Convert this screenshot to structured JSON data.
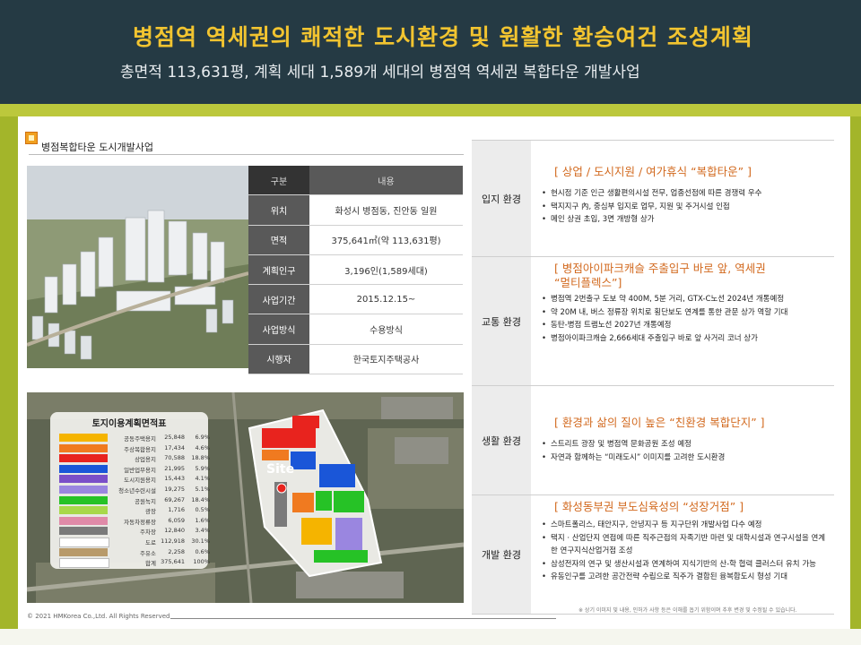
{
  "header": {
    "title": "병점역 역세권의 쾌적한 도시환경 및 원활한 환승여건 조성계획",
    "subtitle": "총면적 113,631평, 계획 세대 1,589개 세대의 병점역 역세권 복합타운 개발사업"
  },
  "section": {
    "title": "병점복합타운 도시개발사업"
  },
  "info": {
    "head": {
      "key": "구분",
      "value": "내용"
    },
    "rows": [
      {
        "key": "위치",
        "value": "화성시 병점동, 진안동 일원"
      },
      {
        "key": "면적",
        "value": "375,641㎡(약 113,631평)"
      },
      {
        "key": "계획인구",
        "value": "3,196인(1,589세대)"
      },
      {
        "key": "사업기간",
        "value": "2015.12.15~"
      },
      {
        "key": "사업방식",
        "value": "수용방식"
      },
      {
        "key": "시행자",
        "value": "한국토지주택공사"
      }
    ]
  },
  "legend": {
    "title": "토지이용계획면적표",
    "rows": [
      {
        "name": "공동주택용지",
        "area": "25,848",
        "pct": "6.9%",
        "color": "#f5b400"
      },
      {
        "name": "주상복합용지",
        "area": "17,434",
        "pct": "4.6%",
        "color": "#f07a20"
      },
      {
        "name": "상업용지",
        "area": "70,588",
        "pct": "18.8%",
        "color": "#e8231e"
      },
      {
        "name": "일반업무용지",
        "area": "21,995",
        "pct": "5.9%",
        "color": "#1a56d8"
      },
      {
        "name": "도시지원용지",
        "area": "15,443",
        "pct": "4.1%",
        "color": "#7a4fc8"
      },
      {
        "name": "청소년수련시설",
        "area": "19,275",
        "pct": "5.1%",
        "color": "#9a86e0"
      },
      {
        "name": "공원녹지",
        "area": "69,267",
        "pct": "18.4%",
        "color": "#26c226"
      },
      {
        "name": "광장",
        "area": "1,716",
        "pct": "0.5%",
        "color": "#a8d84a"
      },
      {
        "name": "자동차정류장",
        "area": "6,059",
        "pct": "1.6%",
        "color": "#e08aa8"
      },
      {
        "name": "주차장",
        "area": "12,840",
        "pct": "3.4%",
        "color": "#7a7a7a"
      },
      {
        "name": "도로",
        "area": "112,918",
        "pct": "30.1%",
        "color": "#ffffff"
      },
      {
        "name": "주유소",
        "area": "2,258",
        "pct": "0.6%",
        "color": "#b89a6a"
      },
      {
        "name": "합계",
        "area": "375,641",
        "pct": "100%",
        "color": "#ffffff"
      }
    ]
  },
  "map": {
    "site_label": "Site"
  },
  "right": {
    "rows": [
      {
        "label": "입지 환경",
        "headline": "[ 상업 / 도시지원 / 여가휴식 “복합타운” ]",
        "bullets": [
          "현시점 기준 인근 생활편의시설 전무, 업종선점에 따른 경쟁력 우수",
          "택지지구 內, 중심부 입지로 업무, 지원 및 주거시설 인접",
          "메인 상권 초입, 3면 개방형 상가"
        ]
      },
      {
        "label": "교통 환경",
        "headline": "[ 병점아이파크캐슬 주출입구 바로 앞, 역세권",
        "headline2": "“멀티플렉스”]",
        "bullets": [
          "병점역 2번출구 도보 약 400M, 5분 거리, GTX-C노선 2024년 개통예정",
          "약 20M 내, 버스 정류장 위치로 횡단보도 연계를 통한 관문 상가 역할 기대",
          "동탄-병점 트램노선 2027년 개통예정",
          "병점아이파크캐슬 2,666세대 주출입구 바로 앞 사거리 코너 상가"
        ]
      },
      {
        "label": "생활 환경",
        "headline": "[ 환경과 삶의 질이 높은 “친환경 복합단지” ]",
        "bullets": [
          "스트리트 광장 및 병점역 문화공원 조성 예정",
          "자연과 함께하는 “미래도시” 이미지를 고려한 도시환경"
        ]
      },
      {
        "label": "개발 환경",
        "headline": "[ 화성동부권 부도심육성의 “성장거점” ]",
        "bullets": [
          "스마트폴리스, 태안지구, 안녕지구 등 지구단위 개발사업 다수 예정",
          "택지 · 산업단지 연접에 따른 직주근접의 자족기반 마련 및 대학시설과 연구시설을 연계한 연구지식산업거점 조성",
          "삼성전자의 연구 및 생산시설과 연계하여 지식기반의 산-학 협력 클러스터 유치 가능",
          "유동인구를 고려한 공간전략 수립으로 직주가 결합된 융복합도시 형성 기대"
        ]
      }
    ]
  },
  "footer": {
    "copyright": "© 2021 HMKorea Co.,Ltd. All Rights Reserved",
    "disclaimer": "※ 상기 이미지 및 내용, 인허가 사항 등은 이해를 돕기 위함이며 추후 변경 및 수정될 수 있습니다."
  }
}
